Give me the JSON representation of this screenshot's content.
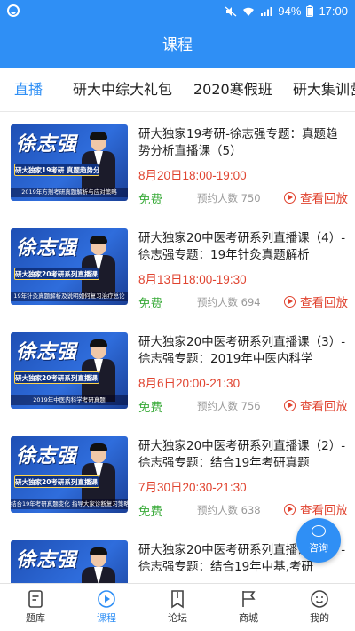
{
  "status_bar": {
    "battery": "94%",
    "time": "17:00"
  },
  "header": {
    "title": "课程"
  },
  "tabs": [
    {
      "label": "直播",
      "active": true
    },
    {
      "label": "研大中综大礼包",
      "active": false
    },
    {
      "label": "2020寒假班",
      "active": false
    },
    {
      "label": "研大集训营",
      "active": false
    }
  ],
  "courses": [
    {
      "thumb_calligraphy": "徐志强",
      "thumb_banner": "研大独家19考研 真题趋势分析直播课（5）",
      "thumb_sub": "2019年方剂考研真题解析与应对策略",
      "title": "研大独家19考研-徐志强专题：真题趋势分析直播课（5）",
      "time": "8月20日18:00-19:00",
      "price": "免费",
      "booked": "预约人数 750",
      "action": "查看回放"
    },
    {
      "thumb_calligraphy": "徐志强",
      "thumb_banner": "研大独家20考研系列直播课（4）",
      "thumb_sub": "19年针灸真题解析及说明如何复习治疗总论",
      "title": "研大独家20中医考研系列直播课（4）-徐志强专题：19年针灸真题解析",
      "time": "8月13日18:00-19:30",
      "price": "免费",
      "booked": "预约人数 694",
      "action": "查看回放"
    },
    {
      "thumb_calligraphy": "徐志强",
      "thumb_banner": "研大独家20考研系列直播课（3）",
      "thumb_sub": "2019年中医内科学考研真题",
      "title": "研大独家20中医考研系列直播课（3）-徐志强专题：2019年中医内科学",
      "time": "8月6日20:00-21:30",
      "price": "免费",
      "booked": "预约人数 756",
      "action": "查看回放"
    },
    {
      "thumb_calligraphy": "徐志强",
      "thumb_banner": "研大独家20考研系列直播课（2）",
      "thumb_sub": "结合19年考研真题变化 指导大家诊断复习策略",
      "title": "研大独家20中医考研系列直播课（2）-徐志强专题：结合19年考研真题",
      "time": "7月30日20:30-21:30",
      "price": "免费",
      "booked": "预约人数 638",
      "action": "查看回放"
    },
    {
      "thumb_calligraphy": "徐志强",
      "thumb_banner": "",
      "thumb_sub": "",
      "title": "研大独家20中医考研系列直播课（1）-徐志强专题：结合19年中基,考研",
      "time": "",
      "price": "",
      "booked": "",
      "action": ""
    }
  ],
  "consult_button": {
    "label": "咨询"
  },
  "bottom_nav": [
    {
      "label": "题库",
      "icon": "document-icon",
      "active": false
    },
    {
      "label": "课程",
      "icon": "play-circle-icon",
      "active": true
    },
    {
      "label": "论坛",
      "icon": "bookmark-icon",
      "active": false
    },
    {
      "label": "商城",
      "icon": "flag-icon",
      "active": false
    },
    {
      "label": "我的",
      "icon": "face-icon",
      "active": false
    }
  ],
  "colors": {
    "primary": "#2f8ff5",
    "time_red": "#e0432f",
    "free_green": "#3aab3a"
  }
}
